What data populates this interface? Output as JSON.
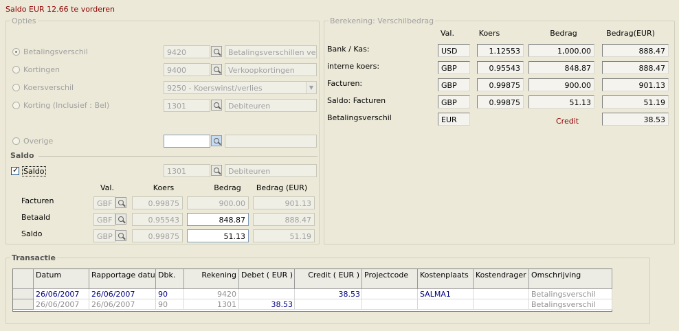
{
  "header": {
    "title": "Saldo EUR 12.66 te vorderen"
  },
  "opties": {
    "legend": "Opties",
    "rows": [
      {
        "label": "Betalingsverschil",
        "code": "9420",
        "desc": "Betalingsverschillen ve",
        "selected": true
      },
      {
        "label": "Kortingen",
        "code": "9400",
        "desc": "Verkoopkortingen",
        "selected": false
      },
      {
        "label": "Koersverschil",
        "dropdown": "9250 - Koerswinst/verlies",
        "selected": false
      },
      {
        "label": "Korting (Inclusief : Bel)",
        "code": "1301",
        "desc": "Debiteuren",
        "selected": false
      }
    ],
    "overige": {
      "label": "Overige",
      "code": "",
      "desc": ""
    }
  },
  "saldo": {
    "section_title": "Saldo",
    "checkbox_label": "Saldo",
    "checked": true,
    "code": "1301",
    "desc": "Debiteuren",
    "headers": {
      "val": "Val.",
      "koers": "Koers",
      "bedrag": "Bedrag",
      "bedrag_eur": "Bedrag (EUR)"
    },
    "rows": [
      {
        "label": "Facturen",
        "val": "GBF",
        "koers": "0.99875",
        "bedrag": "900.00",
        "bedrag_eur": "901.13"
      },
      {
        "label": "Betaald",
        "val": "GBF",
        "koers": "0.95543",
        "bedrag": "848.87",
        "bedrag_eur": "888.47"
      },
      {
        "label": "Saldo",
        "val": "GBP",
        "koers": "0.99875",
        "bedrag": "51.13",
        "bedrag_eur": "51.19"
      }
    ]
  },
  "berekening": {
    "legend": "Berekening: Verschilbedrag",
    "headers": {
      "val": "Val.",
      "koers": "Koers",
      "bedrag": "Bedrag",
      "bedrag_eur": "Bedrag(EUR)"
    },
    "rows": [
      {
        "label": "Bank / Kas:",
        "val": "USD",
        "koers": "1.12553",
        "bedrag": "1,000.00",
        "bedrag_eur": "888.47"
      },
      {
        "label": "interne koers:",
        "val": "GBP",
        "koers": "0.95543",
        "bedrag": "848.87",
        "bedrag_eur": "888.47"
      },
      {
        "label": "Facturen:",
        "val": "GBP",
        "koers": "0.99875",
        "bedrag": "900.00",
        "bedrag_eur": "901.13"
      },
      {
        "label": "Saldo: Facturen",
        "val": "GBP",
        "koers": "0.99875",
        "bedrag": "51.13",
        "bedrag_eur": "51.19"
      }
    ],
    "verschil": {
      "label": "Betalingsverschil",
      "val": "EUR",
      "type": "Credit",
      "bedrag_eur": "38.53"
    }
  },
  "transactie": {
    "legend": "Transactie",
    "columns": [
      "Datum",
      "Rapportage datu",
      "Dbk.",
      "Rekening",
      "Debet ( EUR )",
      "Credit ( EUR )",
      "Projectcode",
      "Kostenplaats",
      "Kostendrager",
      "Omschrijving"
    ],
    "rows": [
      [
        "26/06/2007",
        "26/06/2007",
        "90",
        "9420",
        "",
        "38.53",
        "",
        "SALMA1",
        "",
        "Betalingsverschil"
      ],
      [
        "26/06/2007",
        "26/06/2007",
        "90",
        "1301",
        "38.53",
        "",
        "",
        "",
        "",
        "Betalingsverschil"
      ]
    ]
  }
}
